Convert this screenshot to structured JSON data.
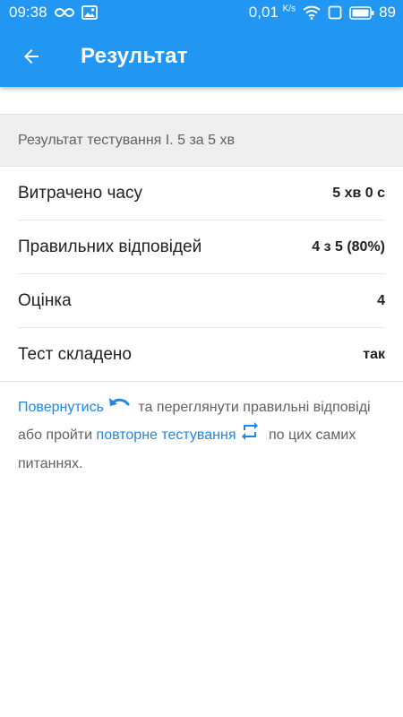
{
  "status_bar": {
    "time": "09:38",
    "speed": "0,01",
    "speed_unit": "K/s",
    "battery": "89"
  },
  "toolbar": {
    "title": "Результат"
  },
  "result": {
    "header": "Результат тестування І. 5 за 5 хв",
    "rows": [
      {
        "label": "Витрачено часу",
        "value": "5 хв 0 с"
      },
      {
        "label": "Правильних відповідей",
        "value": "4 з 5 (80%)"
      },
      {
        "label": "Оцінка",
        "value": "4"
      },
      {
        "label": "Тест складено",
        "value": "так"
      }
    ]
  },
  "info": {
    "link_return": "Повернутись",
    "text_1": "та переглянути правильні відповіді або пройти",
    "link_retry": "повторне тестування",
    "text_2": "по цих самих питаннях."
  },
  "colors": {
    "primary": "#2196f3",
    "link": "#1e88e5",
    "section_bg": "#eeeeee"
  }
}
